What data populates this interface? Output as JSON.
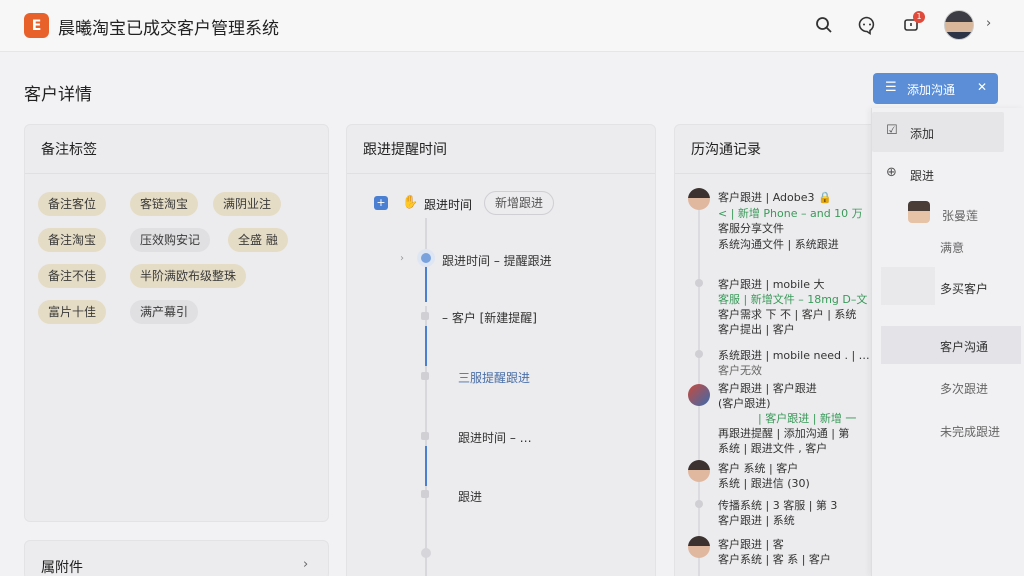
{
  "header": {
    "logo_letter": "E",
    "app_title": "晨曦淘宝已成交客户管理系统",
    "notification_count": "1",
    "icons": [
      "search-icon",
      "chat-icon",
      "bell-icon",
      "chevron-down-icon"
    ]
  },
  "page": {
    "title": "客户详情"
  },
  "notes_card": {
    "title": "备注标签",
    "tags": [
      "备注客位",
      "客链淘宝",
      "满阴业注",
      "备注淘宝",
      "压效购安记",
      "全盛 融",
      "备注不佳",
      "半阶满欧布级整珠",
      "富片十佳",
      "满产幕引"
    ]
  },
  "bottom_card": {
    "title": "属附件"
  },
  "followup_card": {
    "title": "跟进提醒时间",
    "label": "跟进时间",
    "pill": "新增跟进",
    "timeline": [
      "跟进时间 – 提醒跟进",
      "– 客户 [新建提醒]",
      "三服提醒跟进",
      "跟进时间 – …",
      "跟进"
    ]
  },
  "history_card": {
    "title": "历沟通记录",
    "entries": [
      {
        "lines": [
          "客户跟进 | Adobe3 🔒",
          "< | 新增 Phone – and 10 万",
          "客服分享文件",
          "系统沟通文件 | 系统跟进"
        ]
      },
      {
        "lines": [
          "客户跟进 | mobile 大",
          "客服 | 新增文件 – 18mg D–文",
          "客户需求 下 不 | 客户 | 系统",
          "客户提出 | 客户"
        ]
      },
      {
        "lines": [
          "系统跟进 | mobile need . | …",
          "客户无效"
        ]
      },
      {
        "lines": [
          "客户跟进 | 客户跟进",
          "(客户跟进)",
          "| 客户跟进 | 新增 一",
          "再跟进提醒 | 添加沟通 | 第",
          "系统 | 跟进文件 , 客户"
        ]
      },
      {
        "lines": [
          "客户 系统 | 客户",
          "系统 | 跟进信 (30)"
        ]
      },
      {
        "lines": [
          "传播系统 | 3 客服 | 第 3",
          "客户跟进 | 系统"
        ]
      },
      {
        "lines": [
          "客户跟进 | 客",
          "客户系统 | 客 系 | 客户"
        ]
      }
    ]
  },
  "dropdown": {
    "button_label": "添加沟通",
    "items": [
      "添加",
      "跟进"
    ],
    "sub_name": "张曼莲",
    "sub_status": "满意",
    "rows": [
      "多买客户",
      "客户沟通",
      "多次跟进",
      "未完成跟进"
    ]
  }
}
